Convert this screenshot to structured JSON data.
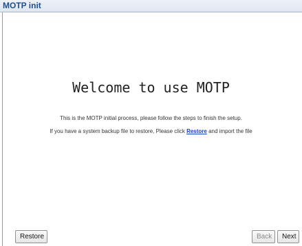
{
  "window": {
    "title": "MOTP init"
  },
  "main": {
    "heading": "Welcome to use MOTP",
    "intro_line": "This is the MOTP initial process, please follow the steps to finish the setup.",
    "restore_line_prefix": "If you have a system backup file to restore, Please click ",
    "restore_link_label": "Restore",
    "restore_line_suffix": " and import the file"
  },
  "footer": {
    "restore_label": "Restore",
    "back_label": "Back",
    "next_label": "Next",
    "back_disabled": true
  },
  "colors": {
    "title": "#1f4f8f",
    "link": "#1a3fc7",
    "disabled_text": "#8a8a8a"
  }
}
